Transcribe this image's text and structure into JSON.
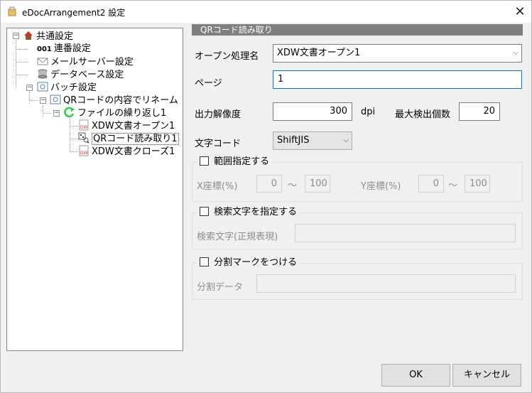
{
  "window": {
    "title": "eDocArrangement2 設定"
  },
  "tree": {
    "items": [
      {
        "label": "共通設定"
      },
      {
        "label": "連番設定",
        "prefix": "001"
      },
      {
        "label": "メールサーバー設定"
      },
      {
        "label": "データベース設定"
      },
      {
        "label": "バッチ設定"
      },
      {
        "label": "QRコードの内容でリネーム"
      },
      {
        "label": "ファイルの繰り返し1"
      },
      {
        "label": "XDW文書オープン1"
      },
      {
        "label": "QRコード読み取り1"
      },
      {
        "label": "XDW文書クローズ1"
      }
    ]
  },
  "panel": {
    "header": "QRコード読み取り",
    "open_label": "オープン処理名",
    "open_value": "XDW文書オープン1",
    "page_label": "ページ",
    "page_value": "1",
    "dpi_label": "出力解像度",
    "dpi_value": "300",
    "dpi_unit": "dpi",
    "max_label": "最大検出個数",
    "max_value": "20",
    "charset_label": "文字コード",
    "charset_value": "ShiftJIS",
    "range": {
      "check_label": "範囲指定する",
      "x_label": "X座標(%)",
      "x_from": "0",
      "x_to": "100",
      "y_label": "Y座標(%)",
      "y_from": "0",
      "y_to": "100",
      "tilde": "～"
    },
    "search": {
      "check_label": "検索文字を指定する",
      "field_label": "検索文字(正規表現)",
      "field_value": ""
    },
    "split": {
      "check_label": "分割マークをつける",
      "field_label": "分割データ",
      "field_value": ""
    }
  },
  "buttons": {
    "ok": "OK",
    "cancel": "キャンセル"
  },
  "colors": {
    "accent": "#0078d7",
    "header_bg": "#7f7f7f",
    "window_bg": "#f0f0f0"
  }
}
